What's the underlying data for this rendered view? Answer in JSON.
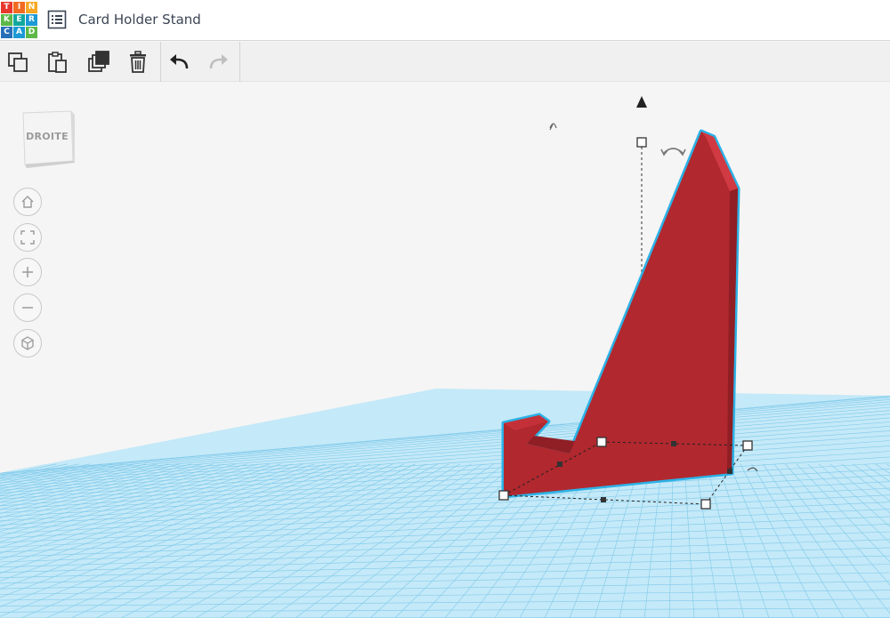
{
  "app": {
    "logo_letters": [
      "T",
      "I",
      "N",
      "K",
      "E",
      "R",
      "C",
      "A",
      "D"
    ],
    "logo_colors": [
      "#e8382e",
      "#f26b21",
      "#f7a823",
      "#5cb947",
      "#13a89e",
      "#1b9ad6",
      "#2770b8",
      "#1b9ad6",
      "#5cb947"
    ],
    "design_title": "Card Holder Stand"
  },
  "toolbar": {
    "items": [
      "copy-icon",
      "paste-icon",
      "duplicate-icon",
      "trash-icon",
      "undo-icon",
      "redo-icon"
    ]
  },
  "viewcube": {
    "face_label": "DROITE"
  },
  "nav_controls": [
    "home-icon",
    "fit-view-icon",
    "zoom-in-icon",
    "zoom-out-icon",
    "orthographic-icon"
  ],
  "shape": {
    "color": "#b1282f",
    "outline": "#2cb2e6"
  }
}
